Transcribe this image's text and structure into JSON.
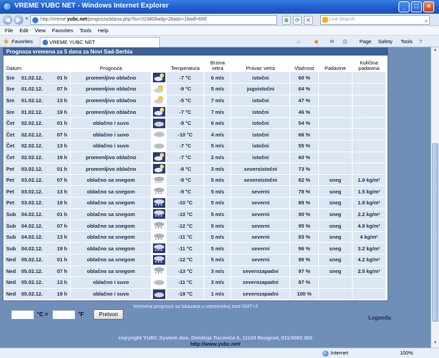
{
  "window": {
    "title": "VREME YUBC NET - Windows Internet Explorer",
    "address_prefix": "http://vreme.",
    "address_domain": "yubc.net",
    "address_rest": "/prognoza3dana.php?kv=319808adg=28adz=18adf=665",
    "search_placeholder": "Live Search"
  },
  "menu": [
    "File",
    "Edit",
    "View",
    "Favorites",
    "Tools",
    "Help"
  ],
  "favorites_label": "Favorites",
  "tab_label": "VREME YUBC NET",
  "commands": [
    "Page",
    "Safety",
    "Tools"
  ],
  "panel_title": "Prognoza vremena za 5 dana za Novi Sad-Serbia",
  "headers": {
    "datum": "Datum",
    "prognoza": "Prognoza",
    "temperatura": "Temperatura",
    "brzina": "Brzina\nvetra",
    "pravac": "Pravac vetra",
    "vlaznost": "Vlažnost",
    "padavine": "Padavine",
    "kolicina": "Količina\npadavina"
  },
  "rows": [
    {
      "day": "Sre",
      "date": "01.02.12.",
      "hour": "01 h",
      "forecast": "promenljivo oblačno",
      "icon": "partly-cloudy-night-icon",
      "temp": "-7 °C",
      "speed": "6 m/s",
      "dir": "istočni",
      "hum": "60 %",
      "precip": "",
      "amount": ""
    },
    {
      "day": "Sre",
      "date": "01.02.12.",
      "hour": "07 h",
      "forecast": "promenljivo oblačno",
      "icon": "partly-cloudy-day-icon",
      "temp": "-9 °C",
      "speed": "5 m/s",
      "dir": "jugoistočni",
      "hum": "64 %",
      "precip": "",
      "amount": ""
    },
    {
      "day": "Sre",
      "date": "01.02.12.",
      "hour": "13 h",
      "forecast": "promenljivo oblačno",
      "icon": "partly-cloudy-day-icon",
      "temp": "-5 °C",
      "speed": "7 m/s",
      "dir": "istočni",
      "hum": "47 %",
      "precip": "",
      "amount": ""
    },
    {
      "day": "Sre",
      "date": "01.02.12.",
      "hour": "19 h",
      "forecast": "promenljivo oblačno",
      "icon": "partly-cloudy-night-icon",
      "temp": "-7 °C",
      "speed": "7 m/s",
      "dir": "istočni",
      "hum": "46 %",
      "precip": "",
      "amount": ""
    },
    {
      "day": "Čet",
      "date": "02.02.12.",
      "hour": "01 h",
      "forecast": "oblačno i suvo",
      "icon": "cloudy-night-icon",
      "temp": "-9 °C",
      "speed": "6 m/s",
      "dir": "istočni",
      "hum": "54 %",
      "precip": "",
      "amount": ""
    },
    {
      "day": "Čet",
      "date": "02.02.12.",
      "hour": "07 h",
      "forecast": "oblačno i suvo",
      "icon": "cloudy-icon",
      "temp": "-10 °C",
      "speed": "4 m/s",
      "dir": "istočni",
      "hum": "66 %",
      "precip": "",
      "amount": ""
    },
    {
      "day": "Čet",
      "date": "02.02.12.",
      "hour": "13 h",
      "forecast": "oblačno i suvo",
      "icon": "cloudy-icon",
      "temp": "-7 °C",
      "speed": "5 m/s",
      "dir": "istočni",
      "hum": "55 %",
      "precip": "",
      "amount": ""
    },
    {
      "day": "Čet",
      "date": "02.02.12.",
      "hour": "19 h",
      "forecast": "promenljivo oblačno",
      "icon": "partly-cloudy-night-icon",
      "temp": "-7 °C",
      "speed": "2 m/s",
      "dir": "istočni",
      "hum": "60 %",
      "precip": "",
      "amount": ""
    },
    {
      "day": "Pet",
      "date": "03.02.12.",
      "hour": "01 h",
      "forecast": "promenljivo oblačno",
      "icon": "partly-cloudy-night-icon",
      "temp": "-8 °C",
      "speed": "3 m/s",
      "dir": "severoistočni",
      "hum": "73 %",
      "precip": "",
      "amount": ""
    },
    {
      "day": "Pet",
      "date": "03.02.12.",
      "hour": "07 h",
      "forecast": "oblačno sa snegom",
      "icon": "snow-icon",
      "temp": "-9 °C",
      "speed": "5 m/s",
      "dir": "severoistočni",
      "hum": "82 %",
      "precip": "sneg",
      "amount": "1.9 kg/m²"
    },
    {
      "day": "Pet",
      "date": "03.02.12.",
      "hour": "13 h",
      "forecast": "oblačno sa snegom",
      "icon": "snow-icon",
      "temp": "-9 °C",
      "speed": "5 m/s",
      "dir": "severni",
      "hum": "78 %",
      "precip": "sneg",
      "amount": "1.5 kg/m²"
    },
    {
      "day": "Pet",
      "date": "03.02.12.",
      "hour": "19 h",
      "forecast": "oblačno sa snegom",
      "icon": "snow-night-icon",
      "temp": "-10 °C",
      "speed": "5 m/s",
      "dir": "severni",
      "hum": "88 %",
      "precip": "sneg",
      "amount": "1.8 kg/m²"
    },
    {
      "day": "Sub",
      "date": "04.02.12.",
      "hour": "01 h",
      "forecast": "oblačno sa snegom",
      "icon": "snow-night-icon",
      "temp": "-10 °C",
      "speed": "5 m/s",
      "dir": "severni",
      "hum": "90 %",
      "precip": "sneg",
      "amount": "2.2 kg/m²"
    },
    {
      "day": "Sub",
      "date": "04.02.12.",
      "hour": "07 h",
      "forecast": "oblačno sa snegom",
      "icon": "snow-icon",
      "temp": "-12 °C",
      "speed": "5 m/s",
      "dir": "severni",
      "hum": "95 %",
      "precip": "sneg",
      "amount": "4.8 kg/m²"
    },
    {
      "day": "Sub",
      "date": "04.02.12.",
      "hour": "13 h",
      "forecast": "oblačno sa snegom",
      "icon": "snow-icon",
      "temp": "-11 °C",
      "speed": "5 m/s",
      "dir": "severni",
      "hum": "93 %",
      "precip": "sneg",
      "amount": "4 kg/m²"
    },
    {
      "day": "Sub",
      "date": "04.02.12.",
      "hour": "19 h",
      "forecast": "oblačno sa snegom",
      "icon": "snow-night-icon",
      "temp": "-11 °C",
      "speed": "5 m/s",
      "dir": "severni",
      "hum": "96 %",
      "precip": "sneg",
      "amount": "3.2 kg/m²"
    },
    {
      "day": "Ned",
      "date": "05.02.12.",
      "hour": "01 h",
      "forecast": "oblačno sa snegom",
      "icon": "snow-night-icon",
      "temp": "-12 °C",
      "speed": "5 m/s",
      "dir": "severni",
      "hum": "96 %",
      "precip": "sneg",
      "amount": "4.2 kg/m²"
    },
    {
      "day": "Ned",
      "date": "05.02.12.",
      "hour": "07 h",
      "forecast": "oblačno sa snegom",
      "icon": "snow-icon",
      "temp": "-13 °C",
      "speed": "3 m/s",
      "dir": "severozapadni",
      "hum": "97 %",
      "precip": "sneg",
      "amount": "2.5 kg/m²"
    },
    {
      "day": "Ned",
      "date": "05.02.12.",
      "hour": "13 h",
      "forecast": "oblačno i suvo",
      "icon": "cloudy-icon",
      "temp": "-11 °C",
      "speed": "3 m/s",
      "dir": "severozapadni",
      "hum": "87 %",
      "precip": "",
      "amount": ""
    },
    {
      "day": "Ned",
      "date": "05.02.12.",
      "hour": "19 h",
      "forecast": "oblačno i suvo",
      "icon": "cloudy-night-icon",
      "temp": "-18 °C",
      "speed": "1 m/s",
      "dir": "severozapadni",
      "hum": "100 %",
      "precip": "",
      "amount": ""
    }
  ],
  "tz_note": "Vremena prognoze su iskazana u vremenskoj zoni GMT+2",
  "converter": {
    "c_label": "°C =",
    "f_label": "°F",
    "button": "Pretvori",
    "c_value": "",
    "f_value": ""
  },
  "legend_link": "Legenda",
  "copyright": "copyright YUBC System doo, Dimitrija Tucovića 6, 11120 Beograd, 011/3083 300",
  "site_url": "http://www.yubc.net/",
  "status": {
    "zone": "Internet",
    "zoom": "100%"
  },
  "colors": {
    "row_bg": "#dce7f3",
    "header_bar": "#3b5f99",
    "page_bg": "#6f8fb8"
  }
}
